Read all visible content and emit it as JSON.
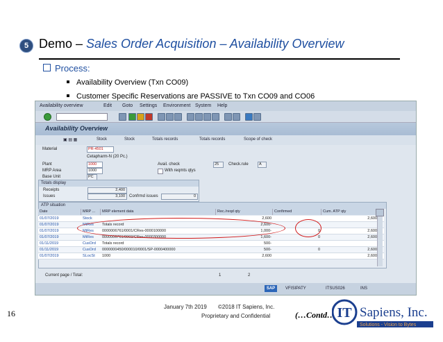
{
  "slide": {
    "section_number": "5",
    "title_prefix": "Demo – ",
    "title_emphasis": "Sales Order Acquisition – Availability Overview",
    "bullet_heading": "Process:",
    "sub_bullets": [
      "Availability Overview (Txn CO09)",
      "Customer Specific Reservations are PASSIVE to Txn CO09 and CO06"
    ],
    "page_number": "16",
    "footer_date": "January 7th 2019",
    "footer_copyright": "©2018 IT Sapiens, Inc.",
    "footer_proprietary": "Proprietary and Confidential",
    "contd": "(…Contd…)",
    "logo": {
      "letters": "IT",
      "name": "Sapiens, Inc.",
      "tagline": "Solutions - Vision to Bytes",
      "accent": "#e07b12",
      "brand": "#1b3f8f"
    }
  },
  "sap": {
    "menu": [
      "Availability overview",
      "Edit",
      "Goto",
      "Settings",
      "Environment",
      "System",
      "Help"
    ],
    "screen_title": "Availability Overview",
    "app_toolbar": [
      "Stock",
      "Stock",
      "Totals records",
      "Totals records",
      "Scope of check"
    ],
    "fields": {
      "material_label": "Material",
      "material_value": "PR-4501",
      "material_desc": "Cetapharm-N (20 Pc.)",
      "plant_label": "Plant",
      "plant_value": "1000",
      "mrp_area_label": "MRP Area",
      "mrp_area_value": "1000",
      "base_unit_label": "Base Unit",
      "base_unit_value": "PC",
      "avail_check_label": "Avail. check",
      "avail_check_value": "25",
      "check_rule_label": "Check.rule",
      "check_rule_value": "A",
      "with_reqmts_label": "With reqmts qtys"
    },
    "totals": {
      "header": "Totals display",
      "receipts_label": "Receipts",
      "receipts_value": "2,400",
      "issues_label": "Issues",
      "issues_value": "3,100",
      "confirmed_label": "Confrmd issues",
      "confirmed_value": "0"
    },
    "atp": {
      "header": "ATP situation",
      "columns": [
        "Date",
        "MRP ...",
        "MRP element data",
        "Rec./reqd qty",
        "Confirmed",
        "Cum. ATP qty"
      ],
      "rows": [
        {
          "date": "01/07/2019",
          "mrp": "Stock",
          "element": "",
          "qty": "2,600",
          "confirmed": "",
          "cum": "2,600"
        },
        {
          "date": "01/07/2019",
          "mrp": "MtRes",
          "element": "Totals record",
          "qty": "2,600-",
          "confirmed": "",
          "cum": ""
        },
        {
          "date": "01/07/2019",
          "mrp": "MtRes",
          "element": "0000006761/0001/CRes-0000100000",
          "qty": "1,000-",
          "confirmed": "0",
          "cum": "2,600"
        },
        {
          "date": "01/07/2019",
          "mrp": "MtRes",
          "element": "0000006761/0003/CRes-0000300000",
          "qty": "1,600-",
          "confirmed": "0",
          "cum": "2,600"
        },
        {
          "date": "01/11/2019",
          "mrp": "CusOrd",
          "element": "Totals record",
          "qty": "500-",
          "confirmed": "",
          "cum": ""
        },
        {
          "date": "01/11/2019",
          "mrp": "CusOrd",
          "element": "0000000450/000010/0001/SP-0000400000",
          "qty": "500-",
          "confirmed": "0",
          "cum": "2,600"
        },
        {
          "date": "01/07/2019",
          "mrp": "SLocSt",
          "element": "1000",
          "qty": "2,600",
          "confirmed": "",
          "cum": "2,600"
        }
      ]
    },
    "pager_label": "Current page / Total:",
    "pager_current": "1",
    "pager_total": "2",
    "status": {
      "sap_logo": "SAP",
      "system": "VFISIPATY",
      "server": "ITSUS026",
      "mode": "INS"
    }
  }
}
